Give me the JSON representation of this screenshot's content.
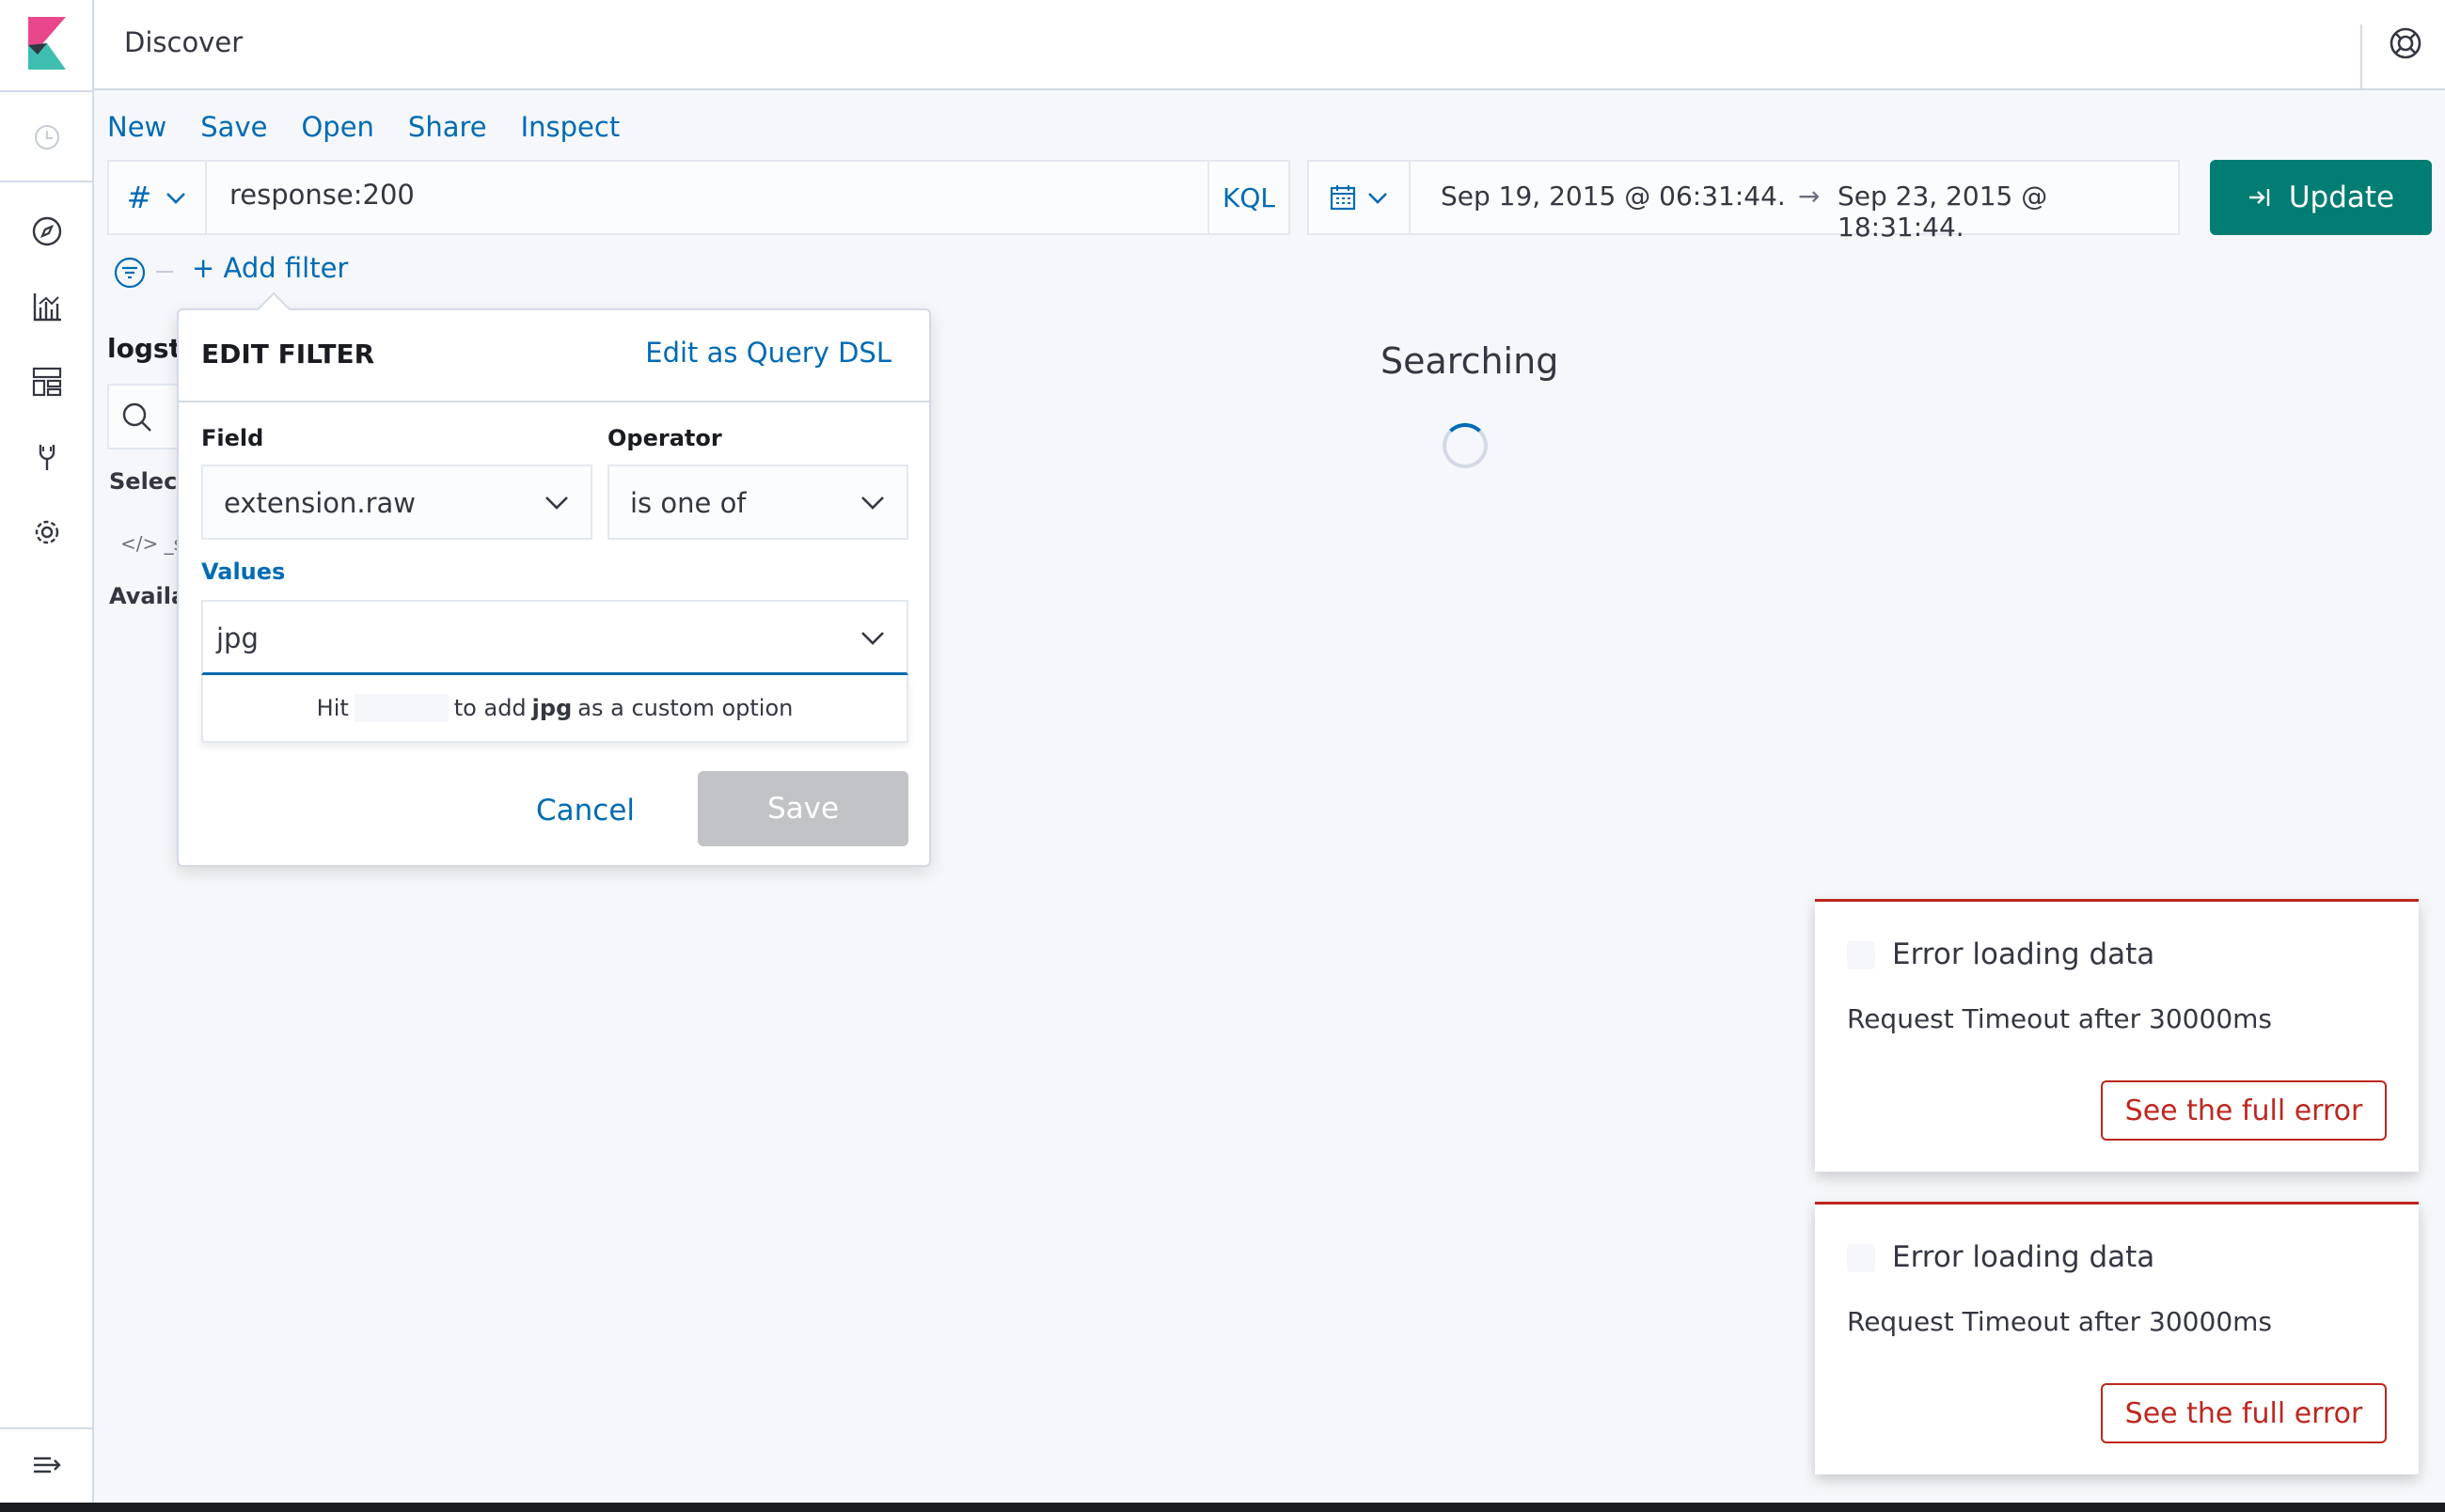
{
  "header": {
    "title": "Discover"
  },
  "topmenu": {
    "new": "New",
    "save": "Save",
    "open": "Open",
    "share": "Share",
    "inspect": "Inspect"
  },
  "query": {
    "type_symbol": "#",
    "value": "response:200",
    "language": "KQL"
  },
  "date": {
    "start": "Sep 19, 2015 @ 06:31:44.",
    "arrow": "→",
    "end": "Sep 23, 2015 @ 18:31:44."
  },
  "update_button": "Update",
  "add_filter": "+ Add filter",
  "sidebar": {
    "index": "logst",
    "selected": "Selec",
    "field": "</>  _s",
    "available": "Availa"
  },
  "main": {
    "status": "Searching"
  },
  "edit_filter": {
    "title": "EDIT FILTER",
    "edit_dsl": "Edit as Query DSL",
    "field_label": "Field",
    "field_value": "extension.raw",
    "operator_label": "Operator",
    "operator_value": "is one of",
    "values_label": "Values",
    "values_value": "jpg",
    "hint_hit": "Hit",
    "hint_to_add": "to add",
    "hint_value": "jpg",
    "hint_suffix": "as a custom option",
    "cancel": "Cancel",
    "save": "Save"
  },
  "toasts": [
    {
      "title": "Error loading data",
      "body": "Request Timeout after 30000ms",
      "button": "See the full error"
    },
    {
      "title": "Error loading data",
      "body": "Request Timeout after 30000ms",
      "button": "See the full error"
    }
  ],
  "colors": {
    "primary": "#006bb4",
    "accent": "#017d73",
    "danger": "#bd271e",
    "logo_pink": "#e8488b",
    "logo_teal": "#3ebeb0"
  }
}
